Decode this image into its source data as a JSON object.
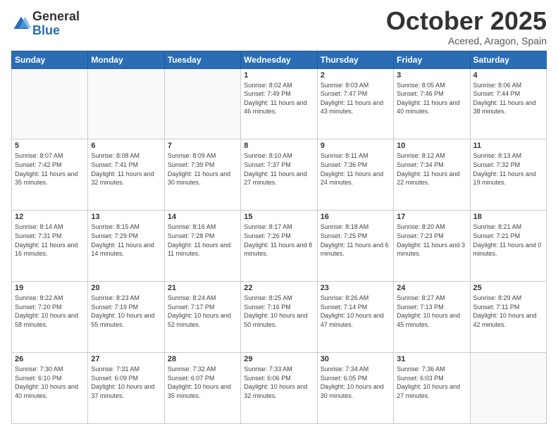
{
  "logo": {
    "general": "General",
    "blue": "Blue"
  },
  "title": "October 2025",
  "location": "Acered, Aragon, Spain",
  "days_of_week": [
    "Sunday",
    "Monday",
    "Tuesday",
    "Wednesday",
    "Thursday",
    "Friday",
    "Saturday"
  ],
  "weeks": [
    [
      {
        "day": "",
        "sunrise": "",
        "sunset": "",
        "daylight": ""
      },
      {
        "day": "",
        "sunrise": "",
        "sunset": "",
        "daylight": ""
      },
      {
        "day": "",
        "sunrise": "",
        "sunset": "",
        "daylight": ""
      },
      {
        "day": "1",
        "sunrise": "8:02 AM",
        "sunset": "7:49 PM",
        "daylight": "11 hours and 46 minutes."
      },
      {
        "day": "2",
        "sunrise": "8:03 AM",
        "sunset": "7:47 PM",
        "daylight": "11 hours and 43 minutes."
      },
      {
        "day": "3",
        "sunrise": "8:05 AM",
        "sunset": "7:46 PM",
        "daylight": "11 hours and 40 minutes."
      },
      {
        "day": "4",
        "sunrise": "8:06 AM",
        "sunset": "7:44 PM",
        "daylight": "11 hours and 38 minutes."
      }
    ],
    [
      {
        "day": "5",
        "sunrise": "8:07 AM",
        "sunset": "7:42 PM",
        "daylight": "11 hours and 35 minutes."
      },
      {
        "day": "6",
        "sunrise": "8:08 AM",
        "sunset": "7:41 PM",
        "daylight": "11 hours and 32 minutes."
      },
      {
        "day": "7",
        "sunrise": "8:09 AM",
        "sunset": "7:39 PM",
        "daylight": "11 hours and 30 minutes."
      },
      {
        "day": "8",
        "sunrise": "8:10 AM",
        "sunset": "7:37 PM",
        "daylight": "11 hours and 27 minutes."
      },
      {
        "day": "9",
        "sunrise": "8:11 AM",
        "sunset": "7:36 PM",
        "daylight": "11 hours and 24 minutes."
      },
      {
        "day": "10",
        "sunrise": "8:12 AM",
        "sunset": "7:34 PM",
        "daylight": "11 hours and 22 minutes."
      },
      {
        "day": "11",
        "sunrise": "8:13 AM",
        "sunset": "7:32 PM",
        "daylight": "11 hours and 19 minutes."
      }
    ],
    [
      {
        "day": "12",
        "sunrise": "8:14 AM",
        "sunset": "7:31 PM",
        "daylight": "11 hours and 16 minutes."
      },
      {
        "day": "13",
        "sunrise": "8:15 AM",
        "sunset": "7:29 PM",
        "daylight": "11 hours and 14 minutes."
      },
      {
        "day": "14",
        "sunrise": "8:16 AM",
        "sunset": "7:28 PM",
        "daylight": "11 hours and 11 minutes."
      },
      {
        "day": "15",
        "sunrise": "8:17 AM",
        "sunset": "7:26 PM",
        "daylight": "11 hours and 8 minutes."
      },
      {
        "day": "16",
        "sunrise": "8:18 AM",
        "sunset": "7:25 PM",
        "daylight": "11 hours and 6 minutes."
      },
      {
        "day": "17",
        "sunrise": "8:20 AM",
        "sunset": "7:23 PM",
        "daylight": "11 hours and 3 minutes."
      },
      {
        "day": "18",
        "sunrise": "8:21 AM",
        "sunset": "7:21 PM",
        "daylight": "11 hours and 0 minutes."
      }
    ],
    [
      {
        "day": "19",
        "sunrise": "8:22 AM",
        "sunset": "7:20 PM",
        "daylight": "10 hours and 58 minutes."
      },
      {
        "day": "20",
        "sunrise": "8:23 AM",
        "sunset": "7:19 PM",
        "daylight": "10 hours and 55 minutes."
      },
      {
        "day": "21",
        "sunrise": "8:24 AM",
        "sunset": "7:17 PM",
        "daylight": "10 hours and 52 minutes."
      },
      {
        "day": "22",
        "sunrise": "8:25 AM",
        "sunset": "7:16 PM",
        "daylight": "10 hours and 50 minutes."
      },
      {
        "day": "23",
        "sunrise": "8:26 AM",
        "sunset": "7:14 PM",
        "daylight": "10 hours and 47 minutes."
      },
      {
        "day": "24",
        "sunrise": "8:27 AM",
        "sunset": "7:13 PM",
        "daylight": "10 hours and 45 minutes."
      },
      {
        "day": "25",
        "sunrise": "8:29 AM",
        "sunset": "7:11 PM",
        "daylight": "10 hours and 42 minutes."
      }
    ],
    [
      {
        "day": "26",
        "sunrise": "7:30 AM",
        "sunset": "6:10 PM",
        "daylight": "10 hours and 40 minutes."
      },
      {
        "day": "27",
        "sunrise": "7:31 AM",
        "sunset": "6:09 PM",
        "daylight": "10 hours and 37 minutes."
      },
      {
        "day": "28",
        "sunrise": "7:32 AM",
        "sunset": "6:07 PM",
        "daylight": "10 hours and 35 minutes."
      },
      {
        "day": "29",
        "sunrise": "7:33 AM",
        "sunset": "6:06 PM",
        "daylight": "10 hours and 32 minutes."
      },
      {
        "day": "30",
        "sunrise": "7:34 AM",
        "sunset": "6:05 PM",
        "daylight": "10 hours and 30 minutes."
      },
      {
        "day": "31",
        "sunrise": "7:36 AM",
        "sunset": "6:03 PM",
        "daylight": "10 hours and 27 minutes."
      },
      {
        "day": "",
        "sunrise": "",
        "sunset": "",
        "daylight": ""
      }
    ]
  ]
}
